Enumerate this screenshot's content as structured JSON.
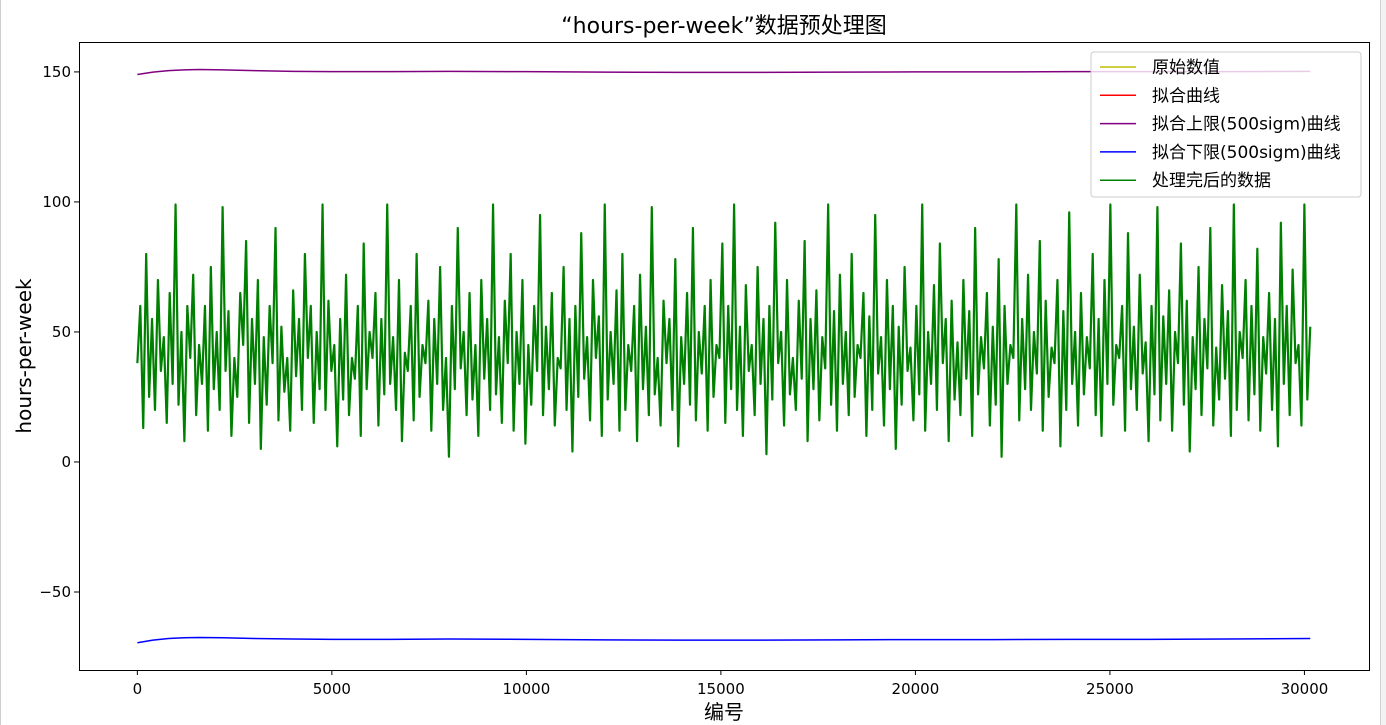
{
  "chart_data": {
    "type": "line",
    "title": "“hours-per-week”数据预处理图",
    "xlabel": "编号",
    "ylabel": "hours-per-week",
    "xlim": [
      -1500,
      31660
    ],
    "ylim": [
      -80,
      161.5
    ],
    "x_ticks": [
      0,
      5000,
      10000,
      15000,
      20000,
      25000,
      30000
    ],
    "x_tick_labels": [
      "0",
      "5000",
      "10000",
      "15000",
      "20000",
      "25000",
      "30000"
    ],
    "y_ticks": [
      150,
      100,
      50,
      0,
      -50
    ],
    "y_tick_labels": [
      "150",
      "100",
      "50",
      "0",
      "−50"
    ],
    "grid": false,
    "legend": "top-right",
    "series": [
      {
        "name": "原始数值",
        "color": "#bfbf00"
      },
      {
        "name": "拟合曲线",
        "color": "#ff0000"
      },
      {
        "name": "拟合上限(500sigm)曲线",
        "color": "#800080",
        "x": [
          0,
          400,
          800,
          1200,
          1600,
          2200,
          3000,
          4000,
          5000,
          6500,
          8000,
          10000,
          12000,
          14000,
          16000,
          18000,
          20000,
          22000,
          24000,
          26000,
          28000,
          30150
        ],
        "values": [
          149.0,
          149.9,
          150.5,
          150.8,
          150.9,
          150.8,
          150.5,
          150.2,
          150.1,
          150.1,
          150.2,
          150.1,
          149.9,
          149.8,
          149.8,
          149.9,
          150.0,
          150.0,
          150.1,
          150.1,
          150.1,
          150.2
        ]
      },
      {
        "name": "拟合下限(500sigm)曲线",
        "color": "#0000ff",
        "x": [
          0,
          400,
          800,
          1200,
          1600,
          2200,
          3000,
          4000,
          5000,
          6500,
          8000,
          10000,
          12000,
          14000,
          16000,
          18000,
          20000,
          22000,
          24000,
          26000,
          28000,
          30150
        ],
        "values": [
          -69.5,
          -68.5,
          -67.9,
          -67.6,
          -67.5,
          -67.6,
          -67.9,
          -68.1,
          -68.2,
          -68.2,
          -68.1,
          -68.2,
          -68.4,
          -68.5,
          -68.5,
          -68.4,
          -68.3,
          -68.3,
          -68.2,
          -68.2,
          -68.1,
          -67.9
        ]
      },
      {
        "name": "处理完后的数据",
        "color": "#008000",
        "x_range": [
          0,
          30150
        ],
        "values": [
          38,
          60,
          13,
          80,
          25,
          55,
          20,
          70,
          35,
          48,
          15,
          65,
          30,
          99,
          22,
          50,
          8,
          60,
          40,
          72,
          18,
          45,
          30,
          60,
          12,
          75,
          28,
          50,
          20,
          98,
          35,
          58,
          10,
          40,
          25,
          65,
          45,
          85,
          15,
          55,
          30,
          70,
          5,
          48,
          22,
          60,
          38,
          90,
          16,
          52,
          27,
          40,
          12,
          66,
          33,
          55,
          20,
          80,
          40,
          60,
          15,
          50,
          28,
          99,
          20,
          62,
          35,
          45,
          6,
          55,
          24,
          72,
          18,
          40,
          32,
          60,
          10,
          84,
          28,
          50,
          40,
          65,
          14,
          55,
          26,
          99,
          30,
          48,
          20,
          70,
          8,
          42,
          35,
          60,
          16,
          80,
          25,
          45,
          38,
          62,
          12,
          55,
          30,
          75,
          20,
          40,
          2,
          60,
          28,
          90,
          36,
          50,
          18,
          65,
          24,
          45,
          10,
          70,
          32,
          55,
          20,
          99,
          26,
          48,
          15,
          62,
          38,
          80,
          12,
          50,
          30,
          70,
          7,
          45,
          22,
          60,
          35,
          95,
          18,
          52,
          28,
          65,
          14,
          40,
          36,
          75,
          20,
          55,
          4,
          60,
          25,
          88,
          32,
          48,
          16,
          70,
          40,
          56,
          10,
          99,
          24,
          50,
          30,
          66,
          12,
          80,
          20,
          45,
          35,
          60,
          8,
          72,
          28,
          52,
          18,
          98,
          26,
          40,
          14,
          62,
          38,
          55,
          20,
          78,
          6,
          48,
          30,
          65,
          22,
          90,
          16,
          50,
          34,
          60,
          12,
          70,
          25,
          45,
          40,
          84,
          15,
          60,
          28,
          99,
          20,
          52,
          10,
          68,
          35,
          45,
          18,
          75,
          30,
          55,
          3,
          60,
          24,
          92,
          38,
          50,
          14,
          70,
          26,
          40,
          20,
          62,
          32,
          85,
          8,
          55,
          28,
          66,
          16,
          48,
          36,
          99,
          22,
          58,
          12,
          72,
          30,
          50,
          18,
          80,
          25,
          45,
          40,
          65,
          10,
          56,
          20,
          95,
          34,
          48,
          14,
          70,
          28,
          60,
          5,
          52,
          22,
          75,
          35,
          44,
          16,
          60,
          26,
          99,
          12,
          50,
          30,
          68,
          20,
          84,
          38,
          55,
          8,
          62,
          24,
          46,
          18,
          70,
          32,
          58,
          10,
          90,
          26,
          48,
          36,
          65,
          14,
          52,
          22,
          78,
          2,
          60,
          30,
          45,
          40,
          99,
          16,
          55,
          28,
          72,
          20,
          50,
          34,
          85,
          12,
          62,
          25,
          44,
          38,
          70,
          6,
          58,
          20,
          96,
          30,
          50,
          14,
          65,
          26,
          48,
          36,
          80,
          18,
          55,
          10,
          70,
          30,
          99,
          22,
          45,
          40,
          60,
          12,
          88,
          28,
          52,
          20,
          72,
          34,
          46,
          8,
          60,
          26,
          98,
          16,
          56,
          30,
          66,
          12,
          50,
          38,
          84,
          22,
          62,
          4,
          48,
          28,
          75,
          18,
          55,
          36,
          90,
          14,
          44,
          24,
          68,
          32,
          58,
          10,
          99,
          20,
          50,
          40,
          70,
          16,
          60,
          26,
          82,
          12,
          48,
          34,
          65,
          20,
          55,
          6,
          92,
          30,
          60,
          18,
          74,
          38,
          45,
          14,
          99,
          24,
          52
        ]
      }
    ]
  }
}
